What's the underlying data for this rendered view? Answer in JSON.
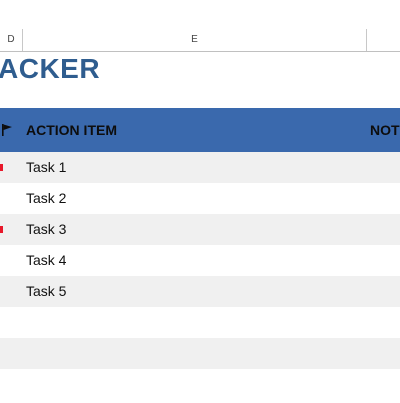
{
  "columns": {
    "d": "D",
    "e": "E",
    "f": ""
  },
  "title": "ACKER",
  "header": {
    "flag_icon": "flag-icon",
    "action_item": "ACTION ITEM",
    "notes": "NOT"
  },
  "rows": [
    {
      "task": "Task 1",
      "flagged": true
    },
    {
      "task": "Task 2",
      "flagged": false
    },
    {
      "task": "Task 3",
      "flagged": true
    },
    {
      "task": "Task 4",
      "flagged": false
    },
    {
      "task": "Task 5",
      "flagged": false
    },
    {
      "task": "",
      "flagged": false
    },
    {
      "task": "",
      "flagged": false
    },
    {
      "task": "",
      "flagged": false
    }
  ],
  "colors": {
    "header_bg": "#3a69ad",
    "title": "#2f5d8f",
    "stripe": "#f0f0f0",
    "flag_marker": "#e8182a"
  }
}
